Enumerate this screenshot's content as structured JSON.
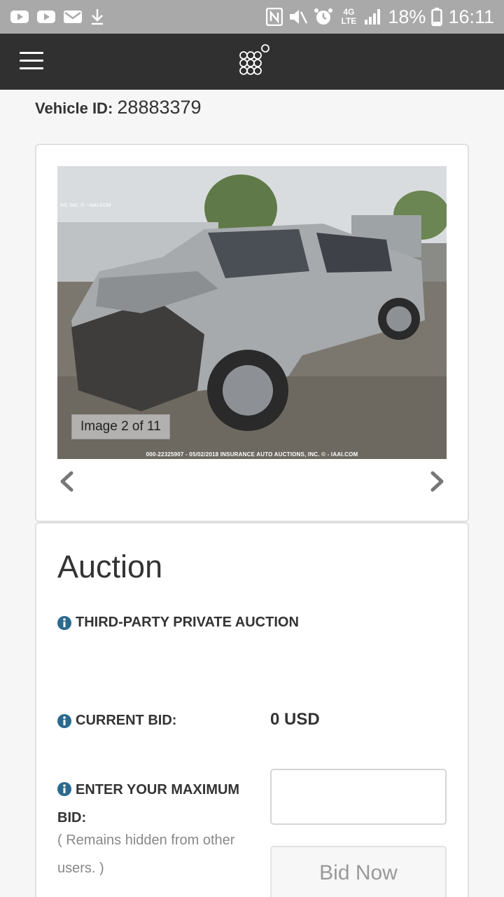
{
  "status_bar": {
    "battery": "18%",
    "time": "16:11",
    "network": "4G LTE",
    "icons": [
      "youtube-icon",
      "youtube-icon",
      "mail-icon",
      "download-icon",
      "nfc-icon",
      "mute-icon",
      "alarm-icon",
      "lte-icon",
      "signal-icon",
      "battery-icon"
    ]
  },
  "app_bar": {
    "menu_icon": "hamburger-icon",
    "logo_icon": "logo-dots-icon"
  },
  "vehicle": {
    "id_label": "Vehicle ID:",
    "id_value": "28883379"
  },
  "gallery": {
    "counter": "Image 2 of 11",
    "watermark": "000-22325907 - 05/02/2018 INSURANCE AUTO AUCTIONS, INC. © - IAAI.COM",
    "prev_icon": "chevron-left-icon",
    "next_icon": "chevron-right-icon"
  },
  "auction": {
    "heading": "Auction",
    "type_label": "THIRD-PARTY PRIVATE AUCTION",
    "current_bid_label": "CURRENT BID:",
    "current_bid_value": "0 USD",
    "max_bid_label": "ENTER YOUR MAXIMUM BID:",
    "max_bid_hint": "( Remains hidden from other users. )",
    "bid_input_value": "",
    "bid_button": "Bid Now",
    "info_icon": "info-icon"
  },
  "colors": {
    "status_bar": "#a9a9a9",
    "app_bar": "#303030",
    "info_icon": "#2b6a8f",
    "page_bg": "#f6f6f6"
  }
}
